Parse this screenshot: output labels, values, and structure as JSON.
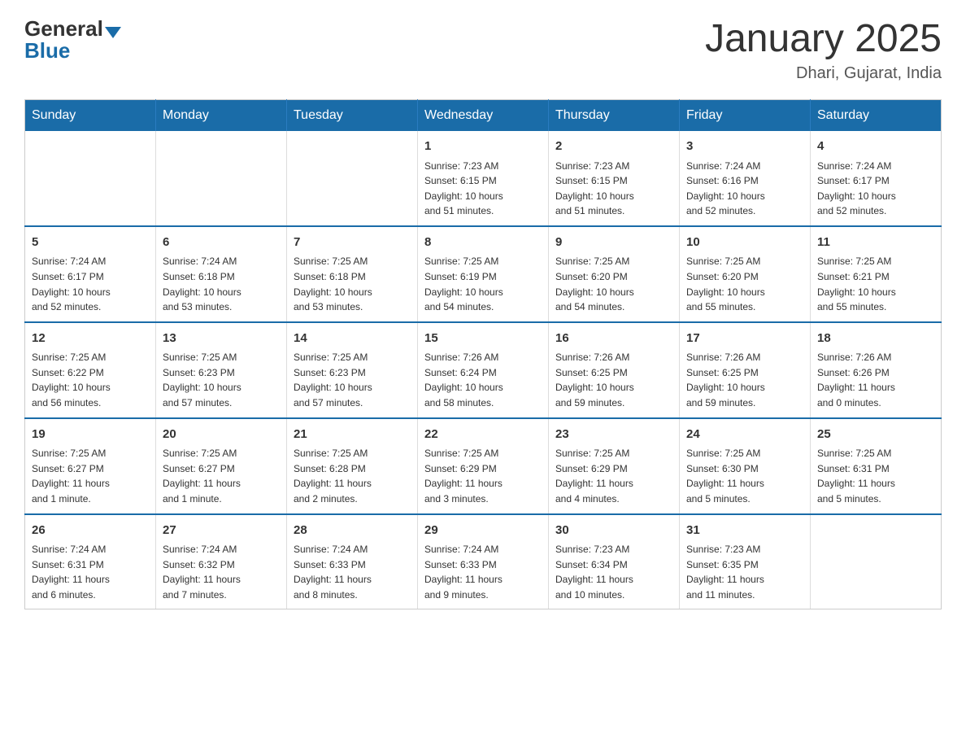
{
  "logo": {
    "general": "General",
    "blue": "Blue"
  },
  "title": "January 2025",
  "location": "Dhari, Gujarat, India",
  "days_of_week": [
    "Sunday",
    "Monday",
    "Tuesday",
    "Wednesday",
    "Thursday",
    "Friday",
    "Saturday"
  ],
  "weeks": [
    [
      {
        "day": "",
        "info": ""
      },
      {
        "day": "",
        "info": ""
      },
      {
        "day": "",
        "info": ""
      },
      {
        "day": "1",
        "info": "Sunrise: 7:23 AM\nSunset: 6:15 PM\nDaylight: 10 hours\nand 51 minutes."
      },
      {
        "day": "2",
        "info": "Sunrise: 7:23 AM\nSunset: 6:15 PM\nDaylight: 10 hours\nand 51 minutes."
      },
      {
        "day": "3",
        "info": "Sunrise: 7:24 AM\nSunset: 6:16 PM\nDaylight: 10 hours\nand 52 minutes."
      },
      {
        "day": "4",
        "info": "Sunrise: 7:24 AM\nSunset: 6:17 PM\nDaylight: 10 hours\nand 52 minutes."
      }
    ],
    [
      {
        "day": "5",
        "info": "Sunrise: 7:24 AM\nSunset: 6:17 PM\nDaylight: 10 hours\nand 52 minutes."
      },
      {
        "day": "6",
        "info": "Sunrise: 7:24 AM\nSunset: 6:18 PM\nDaylight: 10 hours\nand 53 minutes."
      },
      {
        "day": "7",
        "info": "Sunrise: 7:25 AM\nSunset: 6:18 PM\nDaylight: 10 hours\nand 53 minutes."
      },
      {
        "day": "8",
        "info": "Sunrise: 7:25 AM\nSunset: 6:19 PM\nDaylight: 10 hours\nand 54 minutes."
      },
      {
        "day": "9",
        "info": "Sunrise: 7:25 AM\nSunset: 6:20 PM\nDaylight: 10 hours\nand 54 minutes."
      },
      {
        "day": "10",
        "info": "Sunrise: 7:25 AM\nSunset: 6:20 PM\nDaylight: 10 hours\nand 55 minutes."
      },
      {
        "day": "11",
        "info": "Sunrise: 7:25 AM\nSunset: 6:21 PM\nDaylight: 10 hours\nand 55 minutes."
      }
    ],
    [
      {
        "day": "12",
        "info": "Sunrise: 7:25 AM\nSunset: 6:22 PM\nDaylight: 10 hours\nand 56 minutes."
      },
      {
        "day": "13",
        "info": "Sunrise: 7:25 AM\nSunset: 6:23 PM\nDaylight: 10 hours\nand 57 minutes."
      },
      {
        "day": "14",
        "info": "Sunrise: 7:25 AM\nSunset: 6:23 PM\nDaylight: 10 hours\nand 57 minutes."
      },
      {
        "day": "15",
        "info": "Sunrise: 7:26 AM\nSunset: 6:24 PM\nDaylight: 10 hours\nand 58 minutes."
      },
      {
        "day": "16",
        "info": "Sunrise: 7:26 AM\nSunset: 6:25 PM\nDaylight: 10 hours\nand 59 minutes."
      },
      {
        "day": "17",
        "info": "Sunrise: 7:26 AM\nSunset: 6:25 PM\nDaylight: 10 hours\nand 59 minutes."
      },
      {
        "day": "18",
        "info": "Sunrise: 7:26 AM\nSunset: 6:26 PM\nDaylight: 11 hours\nand 0 minutes."
      }
    ],
    [
      {
        "day": "19",
        "info": "Sunrise: 7:25 AM\nSunset: 6:27 PM\nDaylight: 11 hours\nand 1 minute."
      },
      {
        "day": "20",
        "info": "Sunrise: 7:25 AM\nSunset: 6:27 PM\nDaylight: 11 hours\nand 1 minute."
      },
      {
        "day": "21",
        "info": "Sunrise: 7:25 AM\nSunset: 6:28 PM\nDaylight: 11 hours\nand 2 minutes."
      },
      {
        "day": "22",
        "info": "Sunrise: 7:25 AM\nSunset: 6:29 PM\nDaylight: 11 hours\nand 3 minutes."
      },
      {
        "day": "23",
        "info": "Sunrise: 7:25 AM\nSunset: 6:29 PM\nDaylight: 11 hours\nand 4 minutes."
      },
      {
        "day": "24",
        "info": "Sunrise: 7:25 AM\nSunset: 6:30 PM\nDaylight: 11 hours\nand 5 minutes."
      },
      {
        "day": "25",
        "info": "Sunrise: 7:25 AM\nSunset: 6:31 PM\nDaylight: 11 hours\nand 5 minutes."
      }
    ],
    [
      {
        "day": "26",
        "info": "Sunrise: 7:24 AM\nSunset: 6:31 PM\nDaylight: 11 hours\nand 6 minutes."
      },
      {
        "day": "27",
        "info": "Sunrise: 7:24 AM\nSunset: 6:32 PM\nDaylight: 11 hours\nand 7 minutes."
      },
      {
        "day": "28",
        "info": "Sunrise: 7:24 AM\nSunset: 6:33 PM\nDaylight: 11 hours\nand 8 minutes."
      },
      {
        "day": "29",
        "info": "Sunrise: 7:24 AM\nSunset: 6:33 PM\nDaylight: 11 hours\nand 9 minutes."
      },
      {
        "day": "30",
        "info": "Sunrise: 7:23 AM\nSunset: 6:34 PM\nDaylight: 11 hours\nand 10 minutes."
      },
      {
        "day": "31",
        "info": "Sunrise: 7:23 AM\nSunset: 6:35 PM\nDaylight: 11 hours\nand 11 minutes."
      },
      {
        "day": "",
        "info": ""
      }
    ]
  ]
}
